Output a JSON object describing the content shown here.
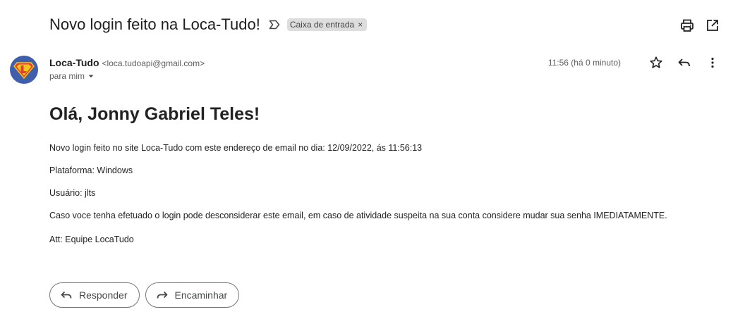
{
  "header": {
    "subject": "Novo login feito na Loca-Tudo!",
    "label_chip": "Caixa de entrada",
    "label_close": "×"
  },
  "sender": {
    "name": "Loca-Tudo",
    "email": "<loca.tudoapi@gmail.com>",
    "recipient": "para mim",
    "timestamp": "11:56 (há 0 minuto)"
  },
  "message": {
    "greeting": "Olá, Jonny Gabriel Teles!",
    "lines": [
      "Novo login feito no site Loca-Tudo com este endereço de email no dia: 12/09/2022, ás 11:56:13",
      "Plataforma: Windows",
      "Usuário: jlts",
      "Caso voce tenha efetuado o login pode desconsiderar este email, em caso de atividade suspeita na sua conta considere mudar sua senha IMEDIATAMENTE.",
      "Att: Equipe LocaTudo"
    ]
  },
  "actions": {
    "reply_label": "Responder",
    "forward_label": "Encaminhar"
  },
  "icons": {
    "important": "label-important-icon",
    "print": "print-icon",
    "open_new_window": "open-in-new-icon",
    "star": "star-icon",
    "reply": "reply-icon",
    "more": "more-vert-icon",
    "caret": "caret-down-icon",
    "forward": "forward-icon"
  },
  "colors": {
    "avatar_bg": "#3f5fad",
    "chip_bg": "#dddddd"
  }
}
